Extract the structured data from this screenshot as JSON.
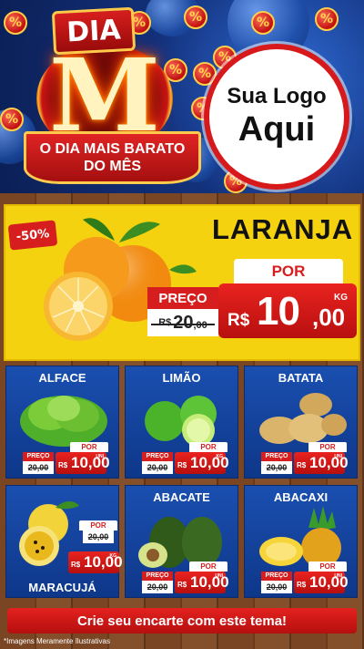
{
  "header": {
    "dia_label": "DIA",
    "m_letter": "M",
    "tagline_line1": "O DIA MAIS BARATO",
    "tagline_line2": "DO MÊS",
    "logo_line1": "Sua Logo",
    "logo_line2": "Aqui",
    "coin_symbol": "%"
  },
  "featured": {
    "discount": "-50%",
    "name": "LARANJA",
    "por_label": "POR",
    "preco_label": "PREÇO",
    "old_currency": "R$",
    "old_int": "20",
    "old_cents": ",00",
    "currency": "R$",
    "price_int": "10",
    "price_cents": ",00",
    "unit": "KG"
  },
  "products": [
    {
      "name": "ALFACE",
      "por": "POR",
      "preco": "PREÇO",
      "old": "20,00",
      "currency": "R$",
      "price": "10,00",
      "unit": "UNI"
    },
    {
      "name": "LIMÃO",
      "por": "POR",
      "preco": "PREÇO",
      "old": "20,00",
      "currency": "R$",
      "price": "10,00",
      "unit": "KG"
    },
    {
      "name": "BATATA",
      "por": "POR",
      "preco": "PREÇO",
      "old": "20,00",
      "currency": "R$",
      "price": "10,00",
      "unit": "UNI"
    },
    {
      "name": "MARACUJÁ",
      "por": "POR",
      "preco": "PREÇO",
      "old": "20,00",
      "currency": "R$",
      "price": "10,00",
      "unit": "KG"
    },
    {
      "name": "ABACATE",
      "por": "POR",
      "preco": "PREÇO",
      "old": "20,00",
      "currency": "R$",
      "price": "10,00",
      "unit": "UNI"
    },
    {
      "name": "ABACAXI",
      "por": "POR",
      "preco": "PREÇO",
      "old": "20,00",
      "currency": "R$",
      "price": "10,00",
      "unit": "UNI"
    }
  ],
  "footer": {
    "cta": "Crie seu encarte com este tema!",
    "disclaimer": "*Imagens Meramente Ilustrativas"
  },
  "colors": {
    "brand_red": "#d71e1e",
    "banner_yellow": "#f4d20f",
    "card_blue": "#1a4fb0",
    "wood": "#7a4523"
  }
}
